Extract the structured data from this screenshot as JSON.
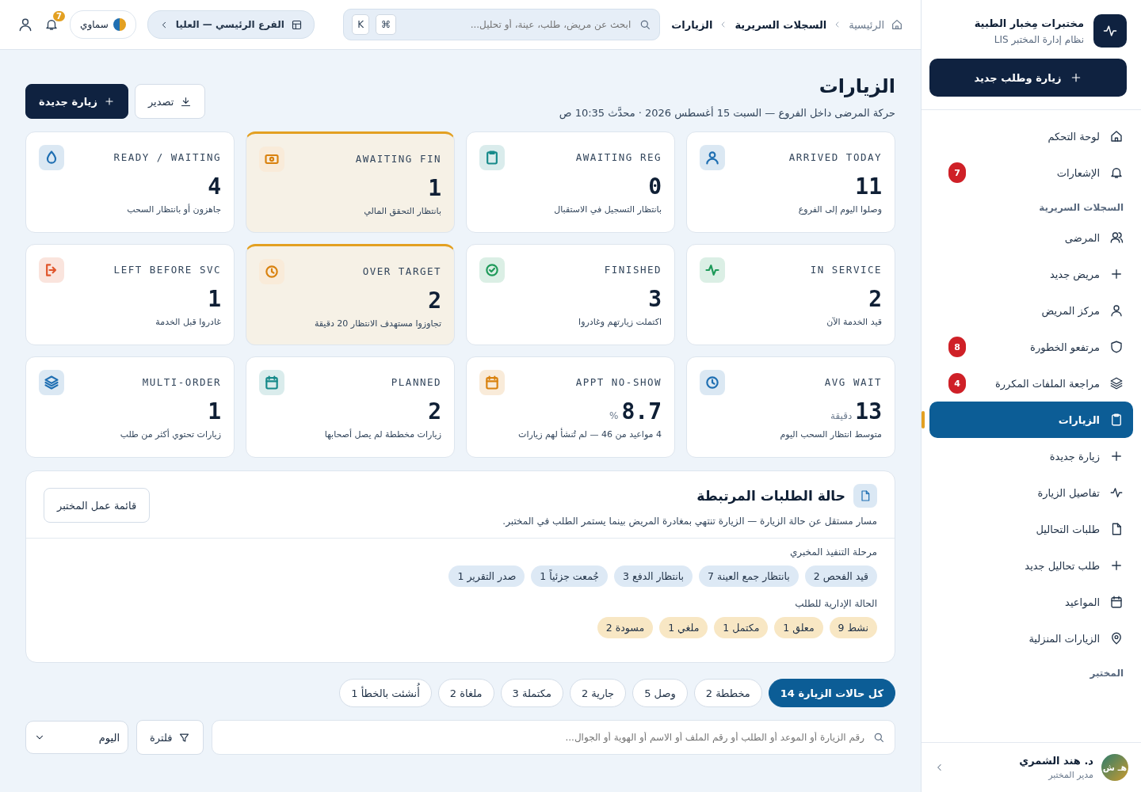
{
  "sidebar": {
    "brand": {
      "name": "مختبرات مِخبار الطبية",
      "subtitle": "نظام إدارة المختبر LIS"
    },
    "primary_button": "زيارة وطلب جديد",
    "nav": [
      {
        "kind": "item",
        "label": "لوحة التحكم",
        "selected": false
      },
      {
        "kind": "item",
        "label": "الإشعارات",
        "selected": false,
        "badge": "7"
      },
      {
        "kind": "section",
        "label": "السجلات السريرية"
      },
      {
        "kind": "item",
        "label": "المرضى",
        "selected": false
      },
      {
        "kind": "item",
        "label": "مريض جديد",
        "selected": false
      },
      {
        "kind": "item",
        "label": "مركز المريض",
        "selected": false
      },
      {
        "kind": "item",
        "label": "مرتفعو الخطورة",
        "selected": false,
        "badge": "8"
      },
      {
        "kind": "item",
        "label": "مراجعة الملفات المكررة",
        "selected": false,
        "badge": "4"
      },
      {
        "kind": "item",
        "label": "الزيارات",
        "selected": true
      },
      {
        "kind": "item",
        "label": "زيارة جديدة",
        "selected": false
      },
      {
        "kind": "item",
        "label": "تفاصيل الزيارة",
        "selected": false
      },
      {
        "kind": "item",
        "label": "طلبات التحاليل",
        "selected": false
      },
      {
        "kind": "item",
        "label": "طلب تحاليل جديد",
        "selected": false
      },
      {
        "kind": "item",
        "label": "المواعيد",
        "selected": false
      },
      {
        "kind": "item",
        "label": "الزيارات المنزلية",
        "selected": false
      },
      {
        "kind": "section",
        "label": "المختبر"
      }
    ],
    "user": {
      "initials": "هـ ش",
      "name": "د. هند الشمري",
      "role": "مدير المختبر"
    }
  },
  "topbar": {
    "breadcrumb": [
      "الرئيسية",
      "السجلات السريرية",
      "الزيارات"
    ],
    "search": {
      "placeholder": "ابحث عن مريض، طلب، عينة، أو تحليل...",
      "keys": [
        "⌘",
        "K"
      ]
    },
    "branch": "الفرع الرئيسي — العليا",
    "theme": "سماوي",
    "notifications": "7"
  },
  "page": {
    "title": "الزيارات",
    "subtitle": "حركة المرضى داخل الفروع — السبت 15 أغسطس 2026 · محدَّث 10:35 ص",
    "actions": [
      "تصدير",
      "زيارة جديدة"
    ]
  },
  "stats": [
    {
      "label": "ARRIVED TODAY",
      "value": "11",
      "sub": "وصلوا اليوم إلى الفروع",
      "color": "#1f6fb2",
      "highlighted": false
    },
    {
      "label": "AWAITING REG",
      "value": "0",
      "sub": "بانتظار التسجيل في الاستقبال",
      "color": "#178a8a",
      "highlighted": false
    },
    {
      "label": "AWAITING FIN",
      "value": "1",
      "sub": "بانتظار التحقق المالي",
      "color": "#d9820f",
      "highlighted": true
    },
    {
      "label": "READY / WAITING",
      "value": "4",
      "sub": "جاهزون أو بانتظار السحب",
      "color": "#1f6fb2",
      "highlighted": false
    },
    {
      "label": "IN SERVICE",
      "value": "2",
      "sub": "قيد الخدمة الآن",
      "color": "#1f9a5a",
      "highlighted": false
    },
    {
      "label": "FINISHED",
      "value": "3",
      "sub": "اكتملت زيارتهم وغادروا",
      "color": "#1f9a5a",
      "highlighted": false
    },
    {
      "label": "OVER TARGET",
      "value": "2",
      "sub": "تجاوزوا مستهدف الانتظار 20 دقيقة",
      "color": "#d9820f",
      "highlighted": true
    },
    {
      "label": "LEFT BEFORE SVC",
      "value": "1",
      "sub": "غادروا قبل الخدمة",
      "color": "#e0552b",
      "highlighted": false
    },
    {
      "label": "AVG WAIT",
      "value": "13",
      "unit": "دقيقة",
      "sub": "متوسط انتظار السحب اليوم",
      "color": "#1f6fb2",
      "highlighted": false
    },
    {
      "label": "APPT NO-SHOW",
      "value": "8.7",
      "unit": "%",
      "sub": "4 مواعيد من 46 — لم تُنشأ لهم زيارات",
      "color": "#d9820f",
      "highlighted": false
    },
    {
      "label": "PLANNED",
      "value": "2",
      "sub": "زيارات مخططة لم يصل أصحابها",
      "color": "#178a8a",
      "highlighted": false
    },
    {
      "label": "MULTI-ORDER",
      "value": "1",
      "sub": "زيارات تحتوي أكثر من طلب",
      "color": "#1f6fb2",
      "highlighted": false
    }
  ],
  "linked_orders": {
    "title": "حالة الطلبات المرتبطة",
    "description": "مسار مستقل عن حالة الزيارة — الزيارة تنتهي بمغادرة المريض بينما يستمر الطلب في المختبر.",
    "button": "قائمة عمل المختبر",
    "groups": [
      {
        "title": "مرحلة التنفيذ المخبري",
        "color": "#dde9f5",
        "pills": [
          "قيد الفحص 2",
          "بانتظار جمع العينة 7",
          "بانتظار الدفع 3",
          "جُمعت جزئياً 1",
          "صدر التقرير 1"
        ]
      },
      {
        "title": "الحالة الإدارية للطلب",
        "color": "#f8e7c4",
        "pills": [
          "نشط 9",
          "معلق 1",
          "مكتمل 1",
          "ملغي 1",
          "مسودة 2"
        ]
      }
    ]
  },
  "filter_tabs": [
    {
      "label": "كل حالات الزيارة 14",
      "selected": true
    },
    {
      "label": "مخططة 2",
      "selected": false
    },
    {
      "label": "وصل 5",
      "selected": false
    },
    {
      "label": "جارية 2",
      "selected": false
    },
    {
      "label": "مكتملة 3",
      "selected": false
    },
    {
      "label": "ملغاة 2",
      "selected": false
    },
    {
      "label": "أُنشئت بالخطأ 1",
      "selected": false
    }
  ],
  "list_search": {
    "placeholder": "رقم الزيارة أو الموعد أو الطلب أو رقم الملف أو الاسم أو الهوية أو الجوال...",
    "filter_button": "فلترة",
    "period": "اليوم"
  }
}
